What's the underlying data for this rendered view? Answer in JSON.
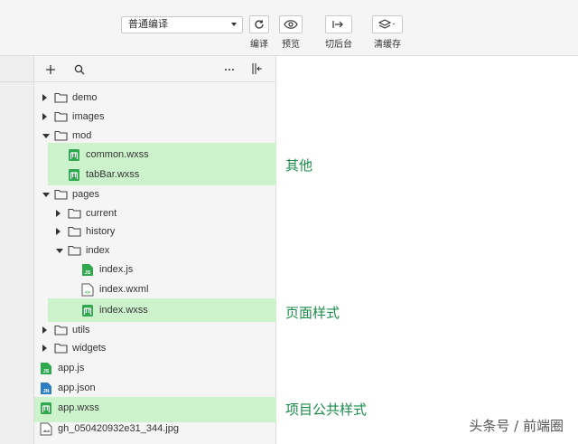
{
  "toolbar": {
    "compile_mode": "普通编译",
    "compile_label": "编译",
    "preview_label": "预览",
    "background_label": "切后台",
    "clear_cache_label": "清缓存"
  },
  "tree": {
    "items": [
      {
        "name": "demo",
        "type": "folder"
      },
      {
        "name": "images",
        "type": "folder"
      },
      {
        "name": "mod",
        "type": "folder"
      },
      {
        "name": "common.wxss",
        "type": "wxss"
      },
      {
        "name": "tabBar.wxss",
        "type": "wxss"
      },
      {
        "name": "pages",
        "type": "folder"
      },
      {
        "name": "current",
        "type": "folder"
      },
      {
        "name": "history",
        "type": "folder"
      },
      {
        "name": "index",
        "type": "folder"
      },
      {
        "name": "index.js",
        "type": "js"
      },
      {
        "name": "index.wxml",
        "type": "wxml"
      },
      {
        "name": "index.wxss",
        "type": "wxss"
      },
      {
        "name": "utils",
        "type": "folder"
      },
      {
        "name": "widgets",
        "type": "folder"
      },
      {
        "name": "app.js",
        "type": "js"
      },
      {
        "name": "app.json",
        "type": "json"
      },
      {
        "name": "app.wxss",
        "type": "wxss"
      },
      {
        "name": "gh_050420932e31_344.jpg",
        "type": "image"
      }
    ]
  },
  "annotations": {
    "other": "其他",
    "page_style": "页面样式",
    "global_style": "项目公共样式"
  },
  "watermark": "头条号 / 前端圈",
  "colors": {
    "highlight": "#cdf3cc",
    "accent_green": "#1a8c4a",
    "icon_green": "#2fa84f",
    "icon_blue": "#2d7fc1"
  }
}
